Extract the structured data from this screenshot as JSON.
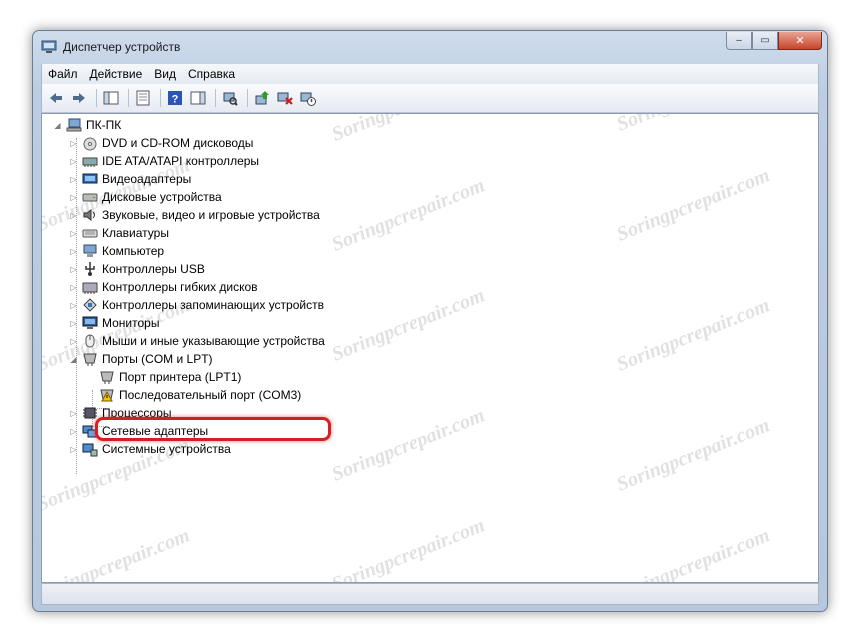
{
  "window": {
    "title": "Диспетчер устройств"
  },
  "menu": [
    {
      "label": "Файл"
    },
    {
      "label": "Действие"
    },
    {
      "label": "Вид"
    },
    {
      "label": "Справка"
    }
  ],
  "toolbar": [
    {
      "name": "back-icon"
    },
    {
      "name": "forward-icon"
    },
    {
      "name": "sep"
    },
    {
      "name": "show-hide-console-tree-icon"
    },
    {
      "name": "sep"
    },
    {
      "name": "properties-icon"
    },
    {
      "name": "sep"
    },
    {
      "name": "help-icon"
    },
    {
      "name": "action-pane-icon"
    },
    {
      "name": "sep"
    },
    {
      "name": "scan-hardware-icon"
    },
    {
      "name": "sep"
    },
    {
      "name": "update-driver-icon"
    },
    {
      "name": "uninstall-icon"
    },
    {
      "name": "disable-device-icon"
    }
  ],
  "tree": {
    "root": "ПК-ПК",
    "categories": [
      {
        "label": "DVD и CD-ROM дисководы",
        "icon": "dvd-icon",
        "expanded": false
      },
      {
        "label": "IDE ATA/ATAPI контроллеры",
        "icon": "ide-controller-icon",
        "expanded": false
      },
      {
        "label": "Видеоадаптеры",
        "icon": "display-adapter-icon",
        "expanded": false
      },
      {
        "label": "Дисковые устройства",
        "icon": "disk-drive-icon",
        "expanded": false
      },
      {
        "label": "Звуковые, видео и игровые устройства",
        "icon": "speaker-icon",
        "expanded": false
      },
      {
        "label": "Клавиатуры",
        "icon": "keyboard-icon",
        "expanded": false
      },
      {
        "label": "Компьютер",
        "icon": "computer-icon",
        "expanded": false
      },
      {
        "label": "Контроллеры USB",
        "icon": "usb-icon",
        "expanded": false
      },
      {
        "label": "Контроллеры гибких дисков",
        "icon": "floppy-controller-icon",
        "expanded": false
      },
      {
        "label": "Контроллеры запоминающих устройств",
        "icon": "storage-controller-icon",
        "expanded": false
      },
      {
        "label": "Мониторы",
        "icon": "monitor-icon",
        "expanded": false
      },
      {
        "label": "Мыши и иные указывающие устройства",
        "icon": "mouse-icon",
        "expanded": false
      },
      {
        "label": "Порты (COM и LPT)",
        "icon": "port-icon",
        "expanded": true,
        "children": [
          {
            "label": "Порт принтера (LPT1)",
            "icon": "port-icon",
            "warning": false
          },
          {
            "label": "Последовательный порт (COM3)",
            "icon": "port-warning-icon",
            "warning": true
          }
        ]
      },
      {
        "label": "Процессоры",
        "icon": "processor-icon",
        "expanded": false
      },
      {
        "label": "Сетевые адаптеры",
        "icon": "network-adapter-icon",
        "expanded": false
      },
      {
        "label": "Системные устройства",
        "icon": "system-device-icon",
        "expanded": false
      }
    ]
  },
  "watermark": "Soringpcrepair.com",
  "colors": {
    "highlight": "#d42020",
    "warning": "#f2c200"
  }
}
